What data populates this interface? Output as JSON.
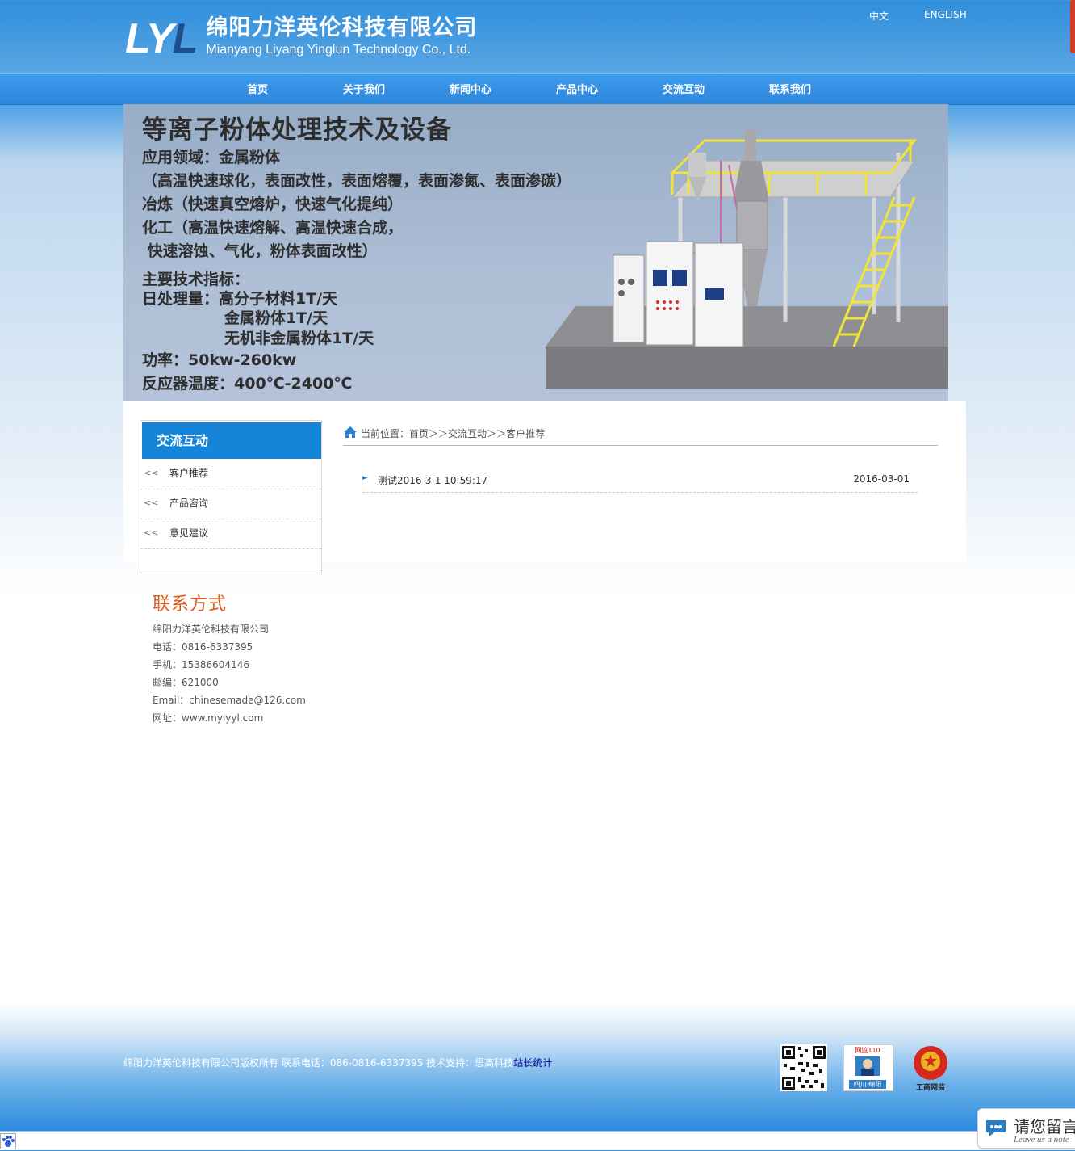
{
  "header": {
    "logo_mark_a": "LY",
    "logo_mark_b": "L",
    "company_cn": "绵阳力洋英伦科技有限公司",
    "company_en": "Mianyang Liyang Yinglun Technology Co., Ltd.",
    "lang_cn": "中文",
    "lang_en": "ENGLISH"
  },
  "nav": {
    "items": [
      "首页",
      "关于我们",
      "新闻中心",
      "产品中心",
      "交流互动",
      "联系我们"
    ]
  },
  "banner": {
    "title": "等离子粉体处理技术及设备",
    "lines": [
      "应用领域：金属粉体",
      "（高温快速球化，表面改性，表面熔覆，表面渗氮、表面渗碳）",
      "冶炼（快速真空熔炉，快速气化提纯）",
      "化工（高温快速熔解、高温快速合成，",
      " 快速溶蚀、气化，粉体表面改性）"
    ],
    "spec_title": "主要技术指标：",
    "capacity": "日处理量：高分子材料1T/天",
    "capacity_2": "金属粉体1T/天",
    "capacity_3": "无机非金属粉体1T/天",
    "power": "功率：50kw-260kw",
    "temperature": "反应器温度：400℃-2400℃"
  },
  "sidebar": {
    "title": "交流互动",
    "arrow": "<<",
    "items": [
      "客户推荐",
      "产品咨询",
      "意见建议"
    ]
  },
  "contact": {
    "title": "联系方式",
    "company": "绵阳力洋英伦科技有限公司",
    "phone": "电话：0816-6337395",
    "mobile": "手机：15386604146",
    "postcode": "邮编：621000",
    "email": "Email：chinesemade@126.com",
    "website": "网址：www.mylyyl.com"
  },
  "breadcrumb": {
    "prefix": "当前位置：",
    "home": "首页",
    "sep": "＞＞",
    "section": "交流互动",
    "current": "客户推荐"
  },
  "list": {
    "items": [
      {
        "title": "测试2016-3-1 10:59:17",
        "date": "2016-03-01"
      }
    ]
  },
  "footer": {
    "copyright": "绵阳力洋英伦科技有限公司版权所有 联系电话：086-0816-6337395 技术支持：思高科技",
    "stats_link": "站长统计",
    "badge_police_top": "网监110",
    "badge_police_bottom": "四川·绵阳",
    "badge_gongshang": "工商网监"
  },
  "message_button": {
    "label": "请您留言",
    "sub": "Leave us a note"
  },
  "colors": {
    "nav_blue": "#2c86da",
    "sidebar_head": "#1584d9",
    "contact_title": "#e05a1a"
  }
}
